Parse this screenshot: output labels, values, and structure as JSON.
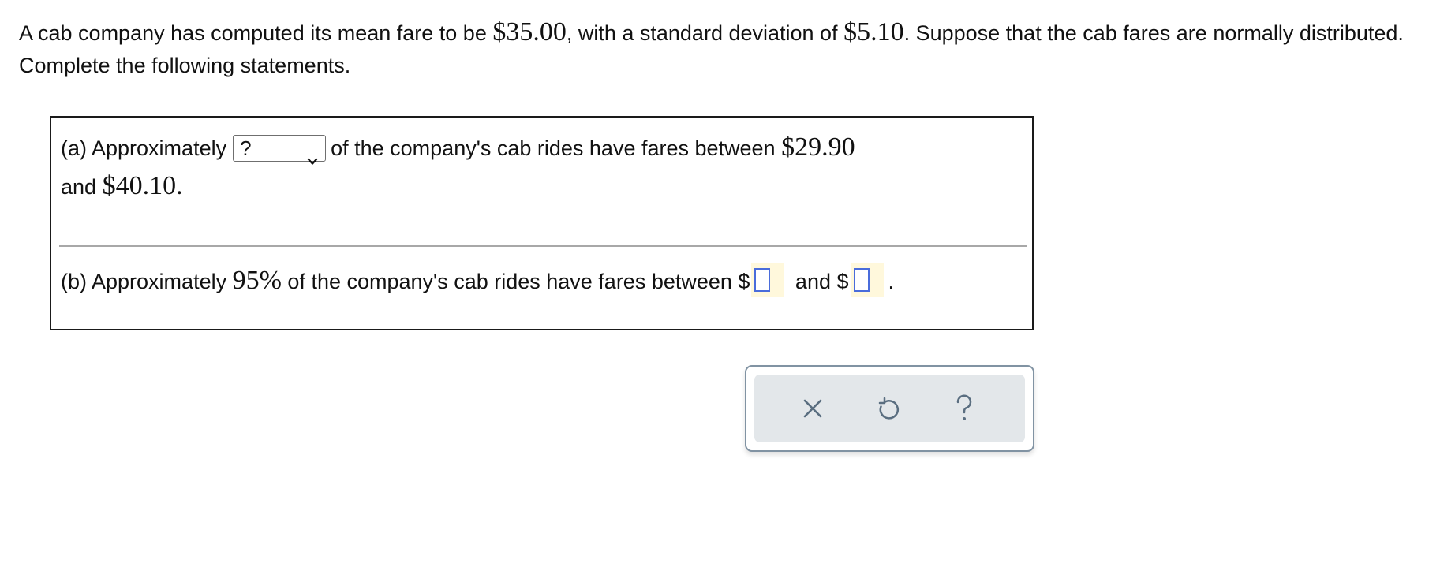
{
  "prompt": {
    "part1": "A cab company has computed its mean fare to be ",
    "mean": "$35.00",
    "part2": ", with a standard deviation of ",
    "sd": "$5.10",
    "part3": ". Suppose that the cab fares are normally distributed. Complete the following statements."
  },
  "part_a": {
    "prefix": "(a) Approximately",
    "select_value": "?",
    "middle": "of the company's cab rides have fares between ",
    "low": "$29.90",
    "and": " and ",
    "high": "$40.10",
    "end": "."
  },
  "part_b": {
    "prefix": "(b) Approximately ",
    "percent": "95%",
    "middle": " of the company's cab rides have fares between $",
    "and": " and $",
    "end": "."
  },
  "toolbar": {
    "buttons": [
      {
        "name": "clear",
        "icon": "close-icon"
      },
      {
        "name": "undo",
        "icon": "undo-icon"
      },
      {
        "name": "help",
        "icon": "help-icon"
      }
    ],
    "icon_color": "#5a6e80"
  },
  "colors": {
    "answer_highlight": "#fff8dc",
    "answer_box_border": "#4a6cdb",
    "toolbar_border": "#8193a3",
    "toolbar_bg": "#e3e7ea"
  }
}
